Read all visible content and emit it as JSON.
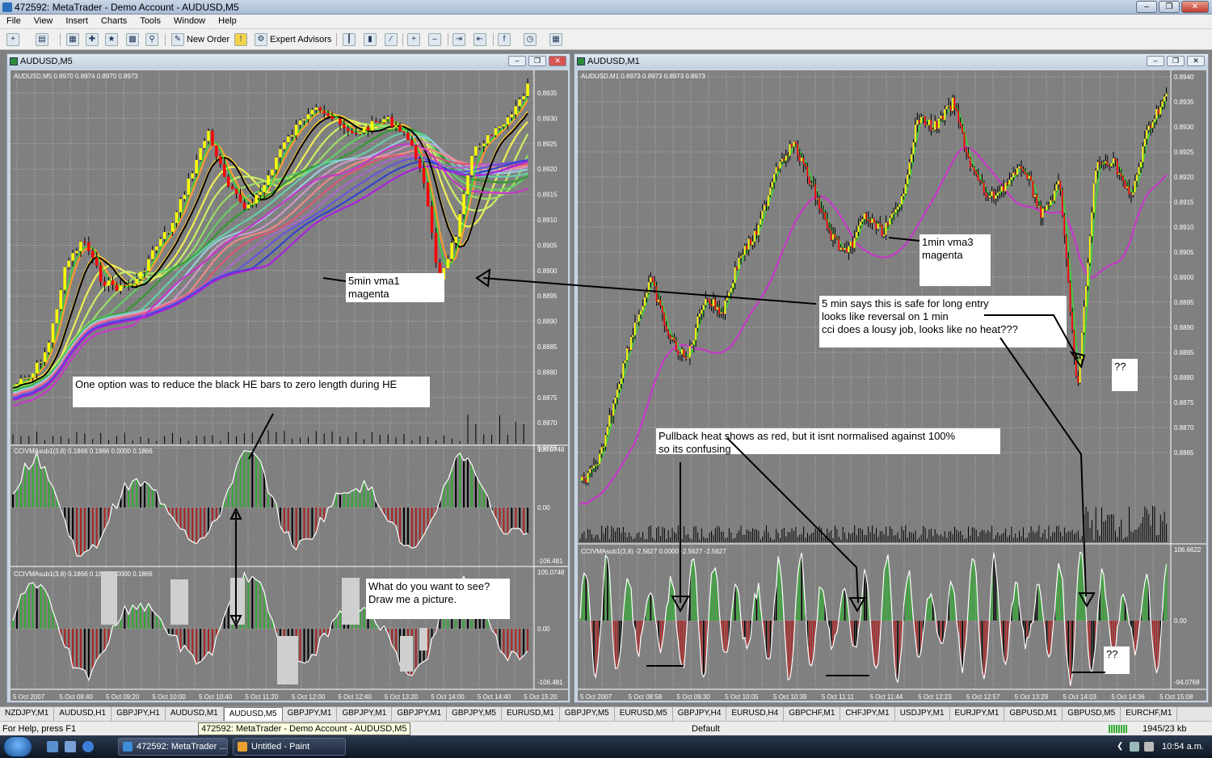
{
  "window": {
    "title": "472592: MetaTrader - Demo Account - AUDUSD,M5"
  },
  "menu": [
    "File",
    "View",
    "Insert",
    "Charts",
    "Tools",
    "Window",
    "Help"
  ],
  "toolbar": {
    "new_order": "New Order",
    "expert_advisors": "Expert Advisors"
  },
  "left_chart": {
    "window_title": "AUDUSD,M5",
    "info": "AUDUSD,M5  0.8970 0.8974 0.8970 0.8973",
    "price_ticks": [
      "0.8935",
      "0.8930",
      "0.8925",
      "0.8920",
      "0.8915",
      "0.8910",
      "0.8905",
      "0.8900",
      "0.8895",
      "0.8890",
      "0.8885",
      "0.8880",
      "0.8875",
      "0.8870",
      "0.8865"
    ],
    "ind1_label": "CCIVMAsub1(3,8) 0.1866 0.1866 0.0000 0.1866",
    "ind1_ticks": [
      "105.0748",
      "0.00",
      "-106.481"
    ],
    "ind2_label": "CCIVMAsub1(3,8) 0.1866 0.1866 0.0000 0.1866",
    "ind2_ticks": [
      "105.0748",
      "0.00",
      "-106.481"
    ],
    "time_ticks": [
      "5 Oct 2007",
      "5 Oct 08:40",
      "5 Oct 09:20",
      "5 Oct 10:00",
      "5 Oct 10:40",
      "5 Oct 11:20",
      "5 Oct 12:00",
      "5 Oct 12:40",
      "5 Oct 13:20",
      "5 Oct 14:00",
      "5 Oct 14:40",
      "5 Oct 15:20"
    ]
  },
  "right_chart": {
    "window_title": "AUDUSD,M1",
    "info": "AUDUSD,M1  0.8973 0.8973 0.8973 0.8973",
    "price_ticks": [
      "0.8940",
      "0.8935",
      "0.8930",
      "0.8925",
      "0.8920",
      "0.8915",
      "0.8910",
      "0.8905",
      "0.8900",
      "0.8895",
      "0.8890",
      "0.8885",
      "0.8880",
      "0.8875",
      "0.8870",
      "0.8865"
    ],
    "ind_label": "CCIVMAsub1(3,8) -2.5627 0.0000 -2.5627 -2.5627",
    "ind_ticks": [
      "106.6622",
      "0.00",
      "-94.0769"
    ],
    "time_ticks": [
      "5 Oct 2007",
      "5 Oct 08:58",
      "5 Oct 09:30",
      "5 Oct 10:05",
      "5 Oct 10:39",
      "5 Oct 11:11",
      "5 Oct 11:44",
      "5 Oct 12:23",
      "5 Oct 12:57",
      "5 Oct 13:29",
      "5 Oct 14:03",
      "5 Oct 14:36",
      "5 Oct 15:08"
    ]
  },
  "notes": {
    "vma1": "5min vma1\nmagenta",
    "vma3": "1min vma3\nmagenta",
    "option": "One option was to reduce the black HE bars to zero length during HE",
    "safe": "5 min says this is safe for long entry\nlooks like reversal on 1 min\ncci does a lousy job, looks like no heat???",
    "pullback": "Pullback heat shows as red, but it isnt normalised against 100%\nso its confusing",
    "whatdo": "What do you want to see?\nDraw me a picture.",
    "q1": "??",
    "q2": "??"
  },
  "tabs": [
    "NZDJPY,M1",
    "AUDUSD,H1",
    "GBPJPY,H1",
    "AUDUSD,M1",
    "AUDUSD,M5",
    "GBPJPY,M1",
    "GBPJPY,M1",
    "GBPJPY,M1",
    "GBPJPY,M5",
    "EURUSD,M1",
    "GBPJPY,M5",
    "EURUSD,M5",
    "GBPJPY,H4",
    "EURUSD,H4",
    "GBPCHF,M1",
    "CHFJPY,M1",
    "USDJPY,M1",
    "EURJPY,M1",
    "GBPUSD,M1",
    "GBPUSD,M5",
    "EURCHF,M1"
  ],
  "status": {
    "help": "For Help, press F1",
    "tooltip": "472592: MetaTrader - Demo Account - AUDUSD,M5",
    "profile": "Default",
    "traffic": "1945/23 kb"
  },
  "taskbar": {
    "task1": "472592: MetaTrader ...",
    "task2": "Untitled - Paint",
    "clock": "10:54 a.m."
  },
  "colors": {
    "chart_bg": "#808080",
    "grid": "#b8b8b8",
    "bull_candle": "#ffff00",
    "bear_candle": "#ff0000",
    "vma": "#cc33cc",
    "hist_green": "#33aa33",
    "hist_red": "#aa2222"
  }
}
